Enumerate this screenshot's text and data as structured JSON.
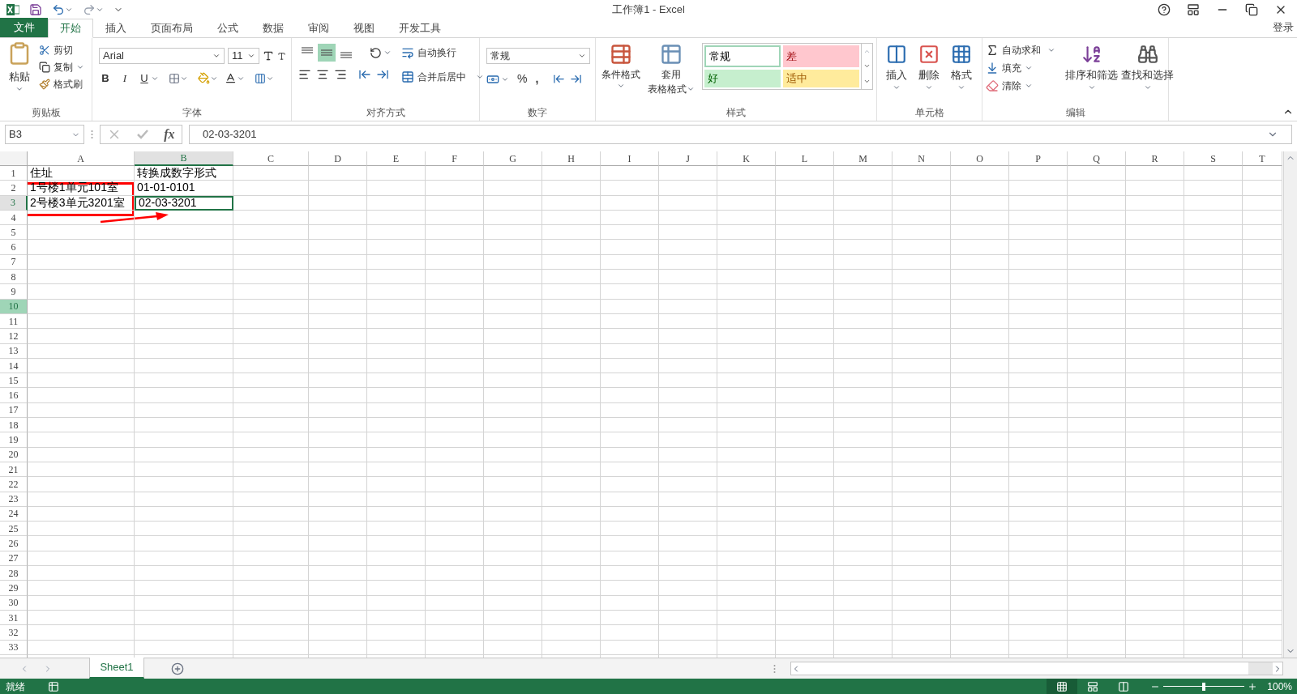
{
  "window": {
    "title": "工作簿1 - Excel"
  },
  "tabs": [
    {
      "label": "文件",
      "kind": "file",
      "selected": false
    },
    {
      "label": "开始",
      "kind": "tab",
      "selected": true
    },
    {
      "label": "插入",
      "kind": "tab",
      "selected": false
    },
    {
      "label": "页面布局",
      "kind": "tab",
      "selected": false
    },
    {
      "label": "公式",
      "kind": "tab",
      "selected": false
    },
    {
      "label": "数据",
      "kind": "tab",
      "selected": false
    },
    {
      "label": "审阅",
      "kind": "tab",
      "selected": false
    },
    {
      "label": "视图",
      "kind": "tab",
      "selected": false
    },
    {
      "label": "开发工具",
      "kind": "tab",
      "selected": false
    }
  ],
  "account": {
    "label": "登录"
  },
  "ribbon": {
    "clipboard": {
      "label": "剪贴板",
      "paste": "粘贴",
      "cut": "剪切",
      "copy": "复制",
      "format_painter": "格式刷"
    },
    "font": {
      "label": "字体",
      "font_name": "Arial",
      "font_size": "11",
      "bold": "B",
      "italic": "I",
      "underline": "U"
    },
    "alignment": {
      "label": "对齐方式",
      "vertical": [
        {
          "selected": false
        },
        {
          "selected": true
        },
        {
          "selected": false
        }
      ],
      "wrap_text": "自动换行",
      "merge_center": "合并后居中"
    },
    "number": {
      "label": "数字",
      "format": "常规",
      "percent": "%",
      "comma": ","
    },
    "styles": {
      "label": "样式",
      "conditional_formatting": "条件格式",
      "format_as_table": [
        "套用",
        "表格格式"
      ],
      "cell_styles": [
        {
          "label": "常规",
          "kind": "normal",
          "color": "#ffffff",
          "selected": true
        },
        {
          "label": "差",
          "kind": "bad",
          "color": "#ffc7ce",
          "selected": false
        },
        {
          "label": "好",
          "kind": "good",
          "color": "#c6efce",
          "selected": false
        },
        {
          "label": "适中",
          "kind": "neutral",
          "color": "#ffeb9c",
          "selected": false
        }
      ]
    },
    "cells": {
      "label": "单元格",
      "insert": "插入",
      "delete": "删除",
      "format": "格式"
    },
    "editing": {
      "label": "编辑",
      "autosum": "自动求和",
      "fill": "填充",
      "clear": "清除",
      "sort_filter": "排序和筛选",
      "find_select": "查找和选择"
    }
  },
  "formula_bar": {
    "name_box": "B3",
    "function_label": "fx",
    "formula": "02-03-3201"
  },
  "sheet": {
    "columns": [
      {
        "label": "A",
        "selected": false
      },
      {
        "label": "B",
        "selected": true
      },
      {
        "label": "C",
        "selected": false
      },
      {
        "label": "D",
        "selected": false
      },
      {
        "label": "E",
        "selected": false
      },
      {
        "label": "F",
        "selected": false
      },
      {
        "label": "G",
        "selected": false
      },
      {
        "label": "H",
        "selected": false
      },
      {
        "label": "I",
        "selected": false
      },
      {
        "label": "J",
        "selected": false
      },
      {
        "label": "K",
        "selected": false
      },
      {
        "label": "L",
        "selected": false
      },
      {
        "label": "M",
        "selected": false
      },
      {
        "label": "N",
        "selected": false
      },
      {
        "label": "O",
        "selected": false
      },
      {
        "label": "P",
        "selected": false
      },
      {
        "label": "Q",
        "selected": false
      },
      {
        "label": "R",
        "selected": false
      },
      {
        "label": "S",
        "selected": false
      },
      {
        "label": "T",
        "selected": false
      }
    ],
    "rows": [
      {
        "label": "1",
        "selected": false,
        "highlighted": false,
        "cells": [
          {
            "text": "住址",
            "selected": false
          },
          {
            "text": "转换成数字形式",
            "selected": false
          }
        ]
      },
      {
        "label": "2",
        "selected": false,
        "highlighted": false,
        "cells": [
          {
            "text": "1号楼1单元101室",
            "selected": false
          },
          {
            "text": "01-01-0101",
            "selected": false
          }
        ]
      },
      {
        "label": "3",
        "selected": true,
        "highlighted": false,
        "cells": [
          {
            "text": "2号楼3单元3201室",
            "selected": false
          },
          {
            "text": "02-03-3201",
            "selected": true
          }
        ]
      },
      {
        "label": "4",
        "selected": false,
        "highlighted": false
      },
      {
        "label": "5",
        "selected": false,
        "highlighted": false
      },
      {
        "label": "6",
        "selected": false,
        "highlighted": false
      },
      {
        "label": "7",
        "selected": false,
        "highlighted": false
      },
      {
        "label": "8",
        "selected": false,
        "highlighted": false
      },
      {
        "label": "9",
        "selected": false,
        "highlighted": false
      },
      {
        "label": "10",
        "selected": false,
        "highlighted": true
      },
      {
        "label": "11",
        "selected": false,
        "highlighted": false
      },
      {
        "label": "12",
        "selected": false,
        "highlighted": false
      },
      {
        "label": "13",
        "selected": false,
        "highlighted": false
      },
      {
        "label": "14",
        "selected": false,
        "highlighted": false
      },
      {
        "label": "15",
        "selected": false,
        "highlighted": false
      },
      {
        "label": "16",
        "selected": false,
        "highlighted": false
      },
      {
        "label": "17",
        "selected": false,
        "highlighted": false
      },
      {
        "label": "18",
        "selected": false,
        "highlighted": false
      },
      {
        "label": "19",
        "selected": false,
        "highlighted": false
      },
      {
        "label": "20",
        "selected": false,
        "highlighted": false
      },
      {
        "label": "21",
        "selected": false,
        "highlighted": false
      },
      {
        "label": "22",
        "selected": false,
        "highlighted": false
      },
      {
        "label": "23",
        "selected": false,
        "highlighted": false
      },
      {
        "label": "24",
        "selected": false,
        "highlighted": false
      },
      {
        "label": "25",
        "selected": false,
        "highlighted": false
      },
      {
        "label": "26",
        "selected": false,
        "highlighted": false
      },
      {
        "label": "27",
        "selected": false,
        "highlighted": false
      },
      {
        "label": "28",
        "selected": false,
        "highlighted": false
      },
      {
        "label": "29",
        "selected": false,
        "highlighted": false
      },
      {
        "label": "30",
        "selected": false,
        "highlighted": false
      },
      {
        "label": "31",
        "selected": false,
        "highlighted": false
      },
      {
        "label": "32",
        "selected": false,
        "highlighted": false
      },
      {
        "label": "33",
        "selected": false,
        "highlighted": false
      }
    ]
  },
  "sheet_tabs": [
    {
      "label": "Sheet1",
      "selected": true
    }
  ],
  "status_bar": {
    "status": "就绪",
    "views": [
      {
        "kind": "normal",
        "selected": true
      },
      {
        "kind": "page_layout",
        "selected": false
      },
      {
        "kind": "page_break",
        "selected": false
      }
    ],
    "zoom": {
      "level": 0.5,
      "reading": "100%"
    }
  }
}
